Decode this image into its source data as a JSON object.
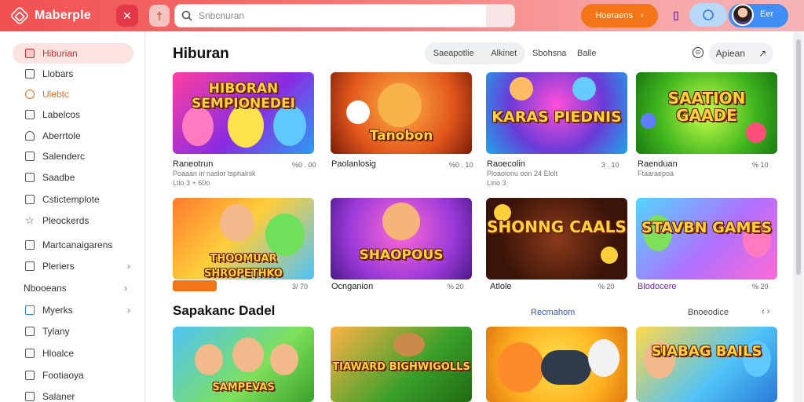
{
  "app": {
    "name": "Maberple"
  },
  "search": {
    "placeholder": "Snbcnuran"
  },
  "header": {
    "cta_label": "Hoeraens",
    "cta_arrow": "›",
    "user_label": "Eer"
  },
  "sidebar": {
    "items": [
      {
        "label": "Hiburian",
        "icon": "home-icon",
        "active": true
      },
      {
        "label": "Llobars",
        "icon": "stack-icon"
      },
      {
        "label": "Ulebtc",
        "icon": "circle-icon"
      },
      {
        "label": "Labelcos",
        "icon": "grid-icon"
      },
      {
        "label": "Aberrtole",
        "icon": "person-icon"
      },
      {
        "label": "Salenderc",
        "icon": "lock-icon"
      },
      {
        "label": "Saadbe",
        "icon": "box-icon"
      },
      {
        "label": "Cstictemplote",
        "icon": "doc-icon"
      },
      {
        "label": "Pleockerds",
        "icon": "star-icon"
      },
      {
        "label": "Martcanaigarens",
        "icon": "calendar-icon"
      },
      {
        "label": "Pleriers",
        "icon": "menu-icon",
        "chevron": true
      }
    ],
    "section_label": "Nbooeans",
    "section_items": [
      {
        "label": "Myerks",
        "icon": "square-icon",
        "chevron": true
      },
      {
        "label": "Tylany",
        "icon": "square-icon"
      },
      {
        "label": "Hloalce",
        "icon": "people-icon"
      },
      {
        "label": "Footiaoya",
        "icon": "square-icon"
      },
      {
        "label": "Salaner",
        "icon": "square-icon"
      }
    ]
  },
  "main": {
    "title": "Hiburan",
    "filters": [
      "Saeapotlie",
      "Alkinet"
    ],
    "filter_extra": [
      "Sbohsna",
      "Balle"
    ],
    "apply_label": "Apiean",
    "apply_icon": "↗",
    "section_title": "Sapakanc Dadel",
    "section_link": "Recmahom",
    "section_link2": "Bnoeodice",
    "section_arrows": "‹ ›"
  },
  "cards_row1": [
    {
      "art_title": "HIBORAN SEMPIONEDEI",
      "name": "Raneotrun",
      "sub1": "Poaaan iri naslor tsphalnik",
      "sub2": "Ltio 3 + 60o",
      "score": "%0 . 00"
    },
    {
      "art_title": "Tanobon",
      "name": "Paolanlosig",
      "sub1": "",
      "sub2": "",
      "score": "%0 . 10"
    },
    {
      "art_title": "KARAS PIEDNIS",
      "name": "Raoecolin",
      "sub1": "Ploaoionu oon 24 Elolt",
      "sub2": "Llno 3",
      "score": "3 . 10"
    },
    {
      "art_title": "SAATION GAADE",
      "name": "Raenduan",
      "sub1": "Ftaaraepoa",
      "sub2": "",
      "score": "% 10"
    }
  ],
  "cards_row2": [
    {
      "art_title": "THOOMUAR SHROPETHKO",
      "name": "",
      "tag": true,
      "score": "3/ 70"
    },
    {
      "art_title": "SHAOPOUS",
      "name": "Ocnganion",
      "score": "% 20"
    },
    {
      "art_title": "SHONNG CAALS",
      "name": "Atlole",
      "score": "% 20"
    },
    {
      "art_title": "STAVBN GAMES",
      "name": "Blodocere",
      "score": "% 20"
    }
  ],
  "cards_row3": [
    {
      "art_title": "SAMPEVAS"
    },
    {
      "art_title": "TIAWARD BIGHWIGOLLS"
    },
    {
      "art_title": ""
    },
    {
      "art_title": "SIABAG BAILS"
    }
  ],
  "colors": {
    "brand": "#f05050",
    "accent": "#f47418",
    "active": "#c8313a"
  }
}
